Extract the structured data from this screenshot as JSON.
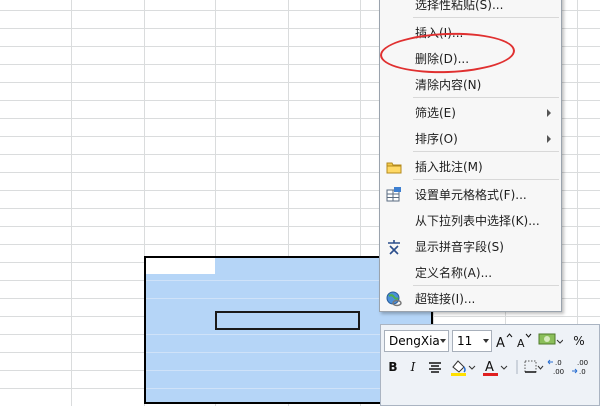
{
  "context_menu": {
    "items": [
      {
        "label": "选择性粘贴(S)...",
        "icon": "",
        "submenu": false
      },
      {
        "label": "插入(I)...",
        "icon": "",
        "submenu": false
      },
      {
        "label": "删除(D)...",
        "icon": "",
        "submenu": false
      },
      {
        "label": "清除内容(N)",
        "icon": "",
        "submenu": false
      },
      {
        "label": "筛选(E)",
        "icon": "",
        "submenu": true
      },
      {
        "label": "排序(O)",
        "icon": "",
        "submenu": true
      },
      {
        "label": "插入批注(M)",
        "icon": "comment-folder-icon",
        "submenu": false
      },
      {
        "label": "设置单元格格式(F)...",
        "icon": "format-cells-icon",
        "submenu": false
      },
      {
        "label": "从下拉列表中选择(K)...",
        "icon": "",
        "submenu": false
      },
      {
        "label": "显示拼音字段(S)",
        "icon": "phonetic-wen-icon",
        "submenu": false
      },
      {
        "label": "定义名称(A)...",
        "icon": "",
        "submenu": false
      },
      {
        "label": "超链接(I)...",
        "icon": "hyperlink-globe-icon",
        "submenu": false
      }
    ]
  },
  "mini_toolbar": {
    "font_name": "DengXia",
    "font_size": "11",
    "percent_label": "%",
    "bold_label": "B",
    "italic_label": "I",
    "font_color": "#e02020",
    "fill_color": "#ffe000"
  },
  "colors": {
    "selection_fill": "#b5d5f7",
    "highlight_ellipse": "#e03030"
  }
}
